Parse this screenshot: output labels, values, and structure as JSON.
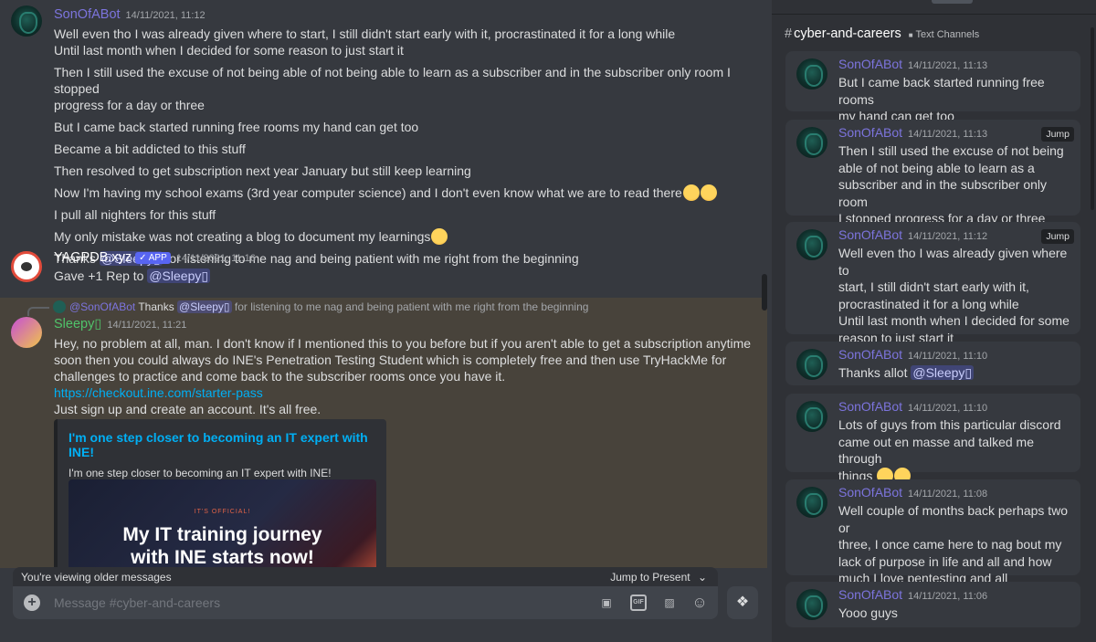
{
  "chat": {
    "messages": [
      {
        "author": "SonOfABot",
        "time": "14/11/2021, 11:12",
        "lines": [
          "Well even tho I was already given where to start, I still didn't start early with it, procrastinated it for a long while",
          "Until last month when I decided for some reason to just start it",
          "Then I still used the excuse of not being able of not being able to learn as a subscriber and in the subscriber only room I stopped",
          "progress for a day or three",
          "But I came back started running free rooms my hand can get too",
          "Became a bit addicted to this stuff",
          "Then resolved to get subscription next year January but still keep learning",
          "Now I'm having my school exams (3rd year computer science) and I don't even know what we are to read there",
          "I pull all nighters for this stuff",
          "My only mistake was not creating a blog to document my learnings",
          "Thanks",
          "for listening to me nag and being patient with me right from the beginning"
        ],
        "mention": "@Sleepy▯"
      },
      {
        "author": "YAGPDB.xyz",
        "badge": "✓ APP",
        "time": "14/11/2021, 11:16",
        "text": "Gave +1 Rep to",
        "mention": "@Sleepy▯"
      },
      {
        "reply_author": "@SonOfABot",
        "reply_text_a": "Thanks",
        "reply_mention": "@Sleepy▯",
        "reply_text_b": "for listening to me nag and being patient with me right from the beginning",
        "author": "Sleepy▯",
        "time": "14/11/2021, 11:21",
        "lines": [
          "Hey, no problem at all, man. I don't know if I mentioned this to you before but if you aren't able to get a subscription anytime",
          "soon then you could always do INE's Penetration Testing Student which is completely free and then use TryHackMe for",
          "challenges to practice and come back to the subscriber rooms once you have it."
        ],
        "link": "https://checkout.ine.com/starter-pass",
        "after_link": "Just sign up and create an account. It's all free.",
        "embed": {
          "title": "I'm one step closer to becoming an IT expert with INE!",
          "description": "I'm one step closer to becoming an IT expert with INE!",
          "image_small": "IT'S OFFICIAL!",
          "image_big_1": "My IT training journey",
          "image_big_2": "with INE starts now!"
        }
      }
    ],
    "older_notice": "You're viewing older messages",
    "jump_to_present": "Jump to Present",
    "composer_placeholder": "Message #cyber-and-careers"
  },
  "side": {
    "channel": "cyber-and-careers",
    "category": "Text Channels",
    "jump_label": "Jump",
    "cards": [
      {
        "author": "SonOfABot",
        "time": "14/11/2021, 11:13",
        "lines": [
          "But I came back started running free rooms",
          "my hand can get too"
        ]
      },
      {
        "author": "SonOfABot",
        "time": "14/11/2021, 11:13",
        "lines": [
          "Then I still used the excuse of not being",
          "able of not being able to learn as a",
          "subscriber and in the subscriber only room",
          "I stopped progress for a day or three"
        ]
      },
      {
        "author": "SonOfABot",
        "time": "14/11/2021, 11:12",
        "lines": [
          "Well even tho I was already given where to",
          "start, I still didn't start early with it,",
          "procrastinated it for a long while",
          "Until last month when I decided for some",
          "reason to just start it"
        ]
      },
      {
        "author": "SonOfABot",
        "time": "14/11/2021, 11:10",
        "text": "Thanks allot",
        "mention": "@Sleepy▯"
      },
      {
        "author": "SonOfABot",
        "time": "14/11/2021, 11:10",
        "lines": [
          "Lots of guys from this particular discord",
          "came out en masse and talked me through",
          "things"
        ]
      },
      {
        "author": "SonOfABot",
        "time": "14/11/2021, 11:08",
        "lines": [
          "Well couple of months back perhaps two or",
          "three, I once came here to nag bout my",
          "lack of purpose in life and all and how",
          "much I love pentesting and all"
        ]
      },
      {
        "author": "SonOfABot",
        "time": "14/11/2021, 11:06",
        "lines": [
          "Yooo guys"
        ]
      }
    ]
  },
  "icons": {
    "plus": "+",
    "gif": "GIF",
    "gift": "▣",
    "sticker": "▨",
    "emoji": "☺",
    "apps": "❖",
    "chevron": "⌄",
    "folder": "■",
    "hash": "#"
  },
  "colors": {
    "background": "#36393f",
    "sidebar": "#2f3136",
    "bot_name": "#7c74dd",
    "sleepy_name": "#50c36a",
    "link": "#00aff4",
    "highlight": "#48433b"
  }
}
